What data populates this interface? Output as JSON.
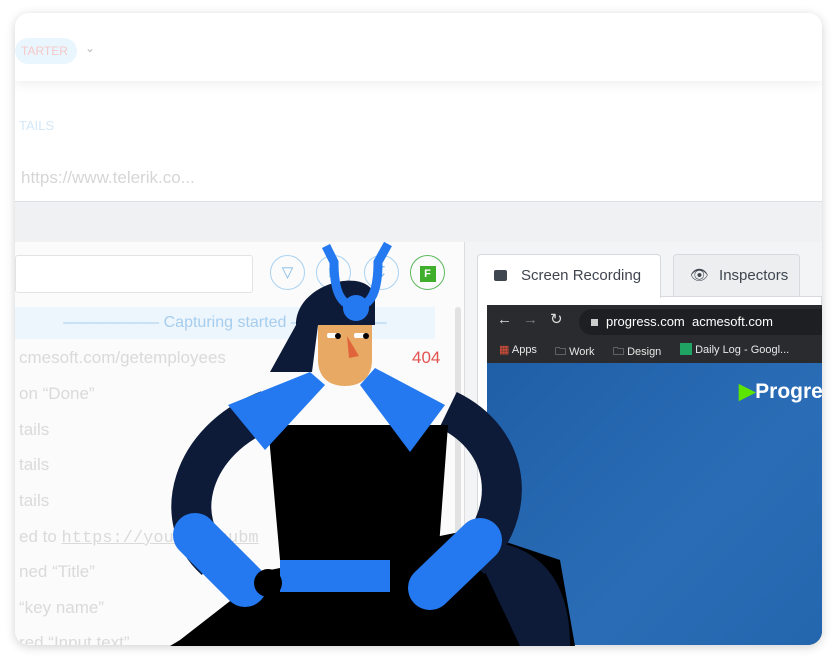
{
  "topbar": {
    "badge": "TARTER",
    "chevron_icon": "chevron-down-icon"
  },
  "details_label": "TAILS",
  "url_text": "https://www.telerik.co...",
  "toolbar": {
    "icons": [
      "filter-icon",
      "copy-icon",
      "download-icon",
      "fiddler-icon"
    ],
    "fiddler_label": "F"
  },
  "log": {
    "capturing": "Capturing started",
    "rows": [
      {
        "text": "cmesoft.com/getemployees",
        "status": "404"
      },
      {
        "text": "on “Done”"
      },
      {
        "text": "tails"
      },
      {
        "text": "tails"
      },
      {
        "text": "tails"
      },
      {
        "text": "ed to ",
        "link": "https://yout",
        "link2": "/subm"
      },
      {
        "text": "ned “Title”"
      },
      {
        "text": "“key name”"
      },
      {
        "text": "red “Input text”"
      }
    ]
  },
  "tabs": [
    {
      "label": "Screen Recording",
      "icon": "video-camera-icon"
    },
    {
      "label": "Inspectors",
      "icon": "eye-icon"
    }
  ],
  "browser": {
    "address": "progress.com",
    "address_suffix": "acmesoft.com",
    "bookmarks": [
      "Apps",
      "Work",
      "Design",
      "Daily Log - Googl..."
    ],
    "site_logo": "Progre"
  },
  "colors": {
    "accent": "#2479f0",
    "navy": "#0d1b38",
    "skin": "#e8a964",
    "error": "#e2534f"
  }
}
